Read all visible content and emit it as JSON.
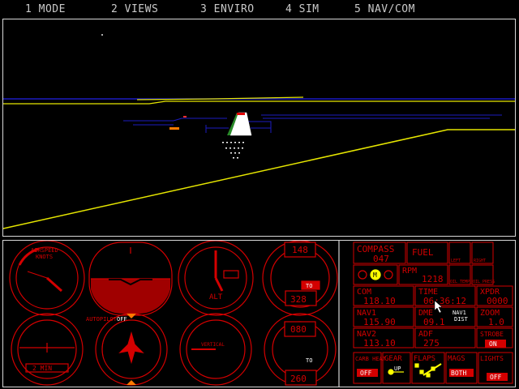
{
  "menu": [
    {
      "label": "1 MODE"
    },
    {
      "label": "2 VIEWS"
    },
    {
      "label": "3 ENVIRO"
    },
    {
      "label": "4 SIM"
    },
    {
      "label": "5 NAV/COM"
    }
  ],
  "instruments": {
    "airspeed_label": "AIRSPEED",
    "airspeed_unit": "KNOTS",
    "altimeter_text": "ALT",
    "turn_text": "2 MIN",
    "vsi_text": "VERTICAL",
    "ias": "148",
    "target_alt": "328",
    "to_flag": "TO",
    "obs2": "080",
    "target2": "260",
    "to_flag2": "TO",
    "autopilot_label": "AUTOPILOT",
    "autopilot_state": "OFF"
  },
  "right_panel": {
    "compass_label": "COMPASS",
    "compass_value": "047",
    "fuel_label": "FUEL",
    "fuel_left": "LEFT",
    "fuel_right": "RIGHT",
    "oil_temp": "OIL TEMP",
    "oil_press": "OIL PRESS",
    "marker": "M",
    "rpm_label": "RPM",
    "rpm_value": "1218",
    "com_label": "COM",
    "com_value": "118.10",
    "time_label": "TIME",
    "time_value": "06:36:12",
    "xpdr_label": "XPDR",
    "xpdr_value": "0000",
    "nav1_label": "NAV1",
    "nav1_value": "115.90",
    "dme_label": "DME",
    "dme_value": "09.1",
    "dme_source": "NAV1",
    "dme_unit": "DIST",
    "zoom_label": "ZOOM",
    "zoom_value": "1.0",
    "nav2_label": "NAV2",
    "nav2_value": "113.10",
    "adf_label": "ADF",
    "adf_value": "275",
    "strobe_label": "STROBE",
    "strobe_state": "ON",
    "carb_label": "CARB HEAT",
    "carb_state": "OFF",
    "gear_label": "GEAR",
    "gear_state": "UP",
    "flaps_label": "FLAPS",
    "mags_label": "MAGS",
    "mags_state": "BOTH",
    "lights_label": "LIGHTS",
    "lights_state": "OFF"
  },
  "colors": {
    "instrument_red": "#d40000",
    "horizon_yellow": "#e6e600",
    "runway_blue": "#1c1cc0",
    "amber": "#ff7a00"
  }
}
